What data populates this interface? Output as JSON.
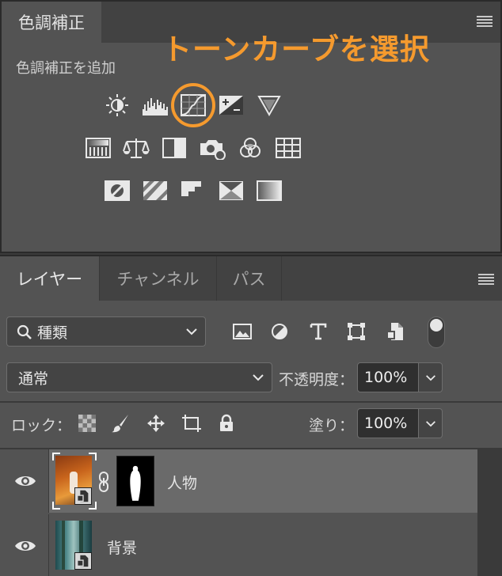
{
  "adjustments": {
    "tab_label": "色調補正",
    "add_label": "色調補正を追加",
    "annotation": "トーンカーブを選択",
    "accent": "#f59a2e",
    "icons_row1": [
      "brightness-contrast-icon",
      "levels-icon",
      "curves-icon",
      "exposure-icon",
      "vibrance-icon"
    ],
    "icons_row2": [
      "hue-saturation-icon",
      "color-balance-icon",
      "black-white-icon",
      "photo-filter-icon",
      "channel-mixer-icon",
      "color-lookup-icon"
    ],
    "icons_row3": [
      "invert-icon",
      "posterize-icon",
      "threshold-icon",
      "selective-color-icon",
      "gradient-map-icon"
    ]
  },
  "layers_panel": {
    "tabs": [
      {
        "label": "レイヤー",
        "active": true
      },
      {
        "label": "チャンネル",
        "active": false
      },
      {
        "label": "パス",
        "active": false
      }
    ],
    "filter": {
      "label": "種類"
    },
    "blend_mode": {
      "value": "通常"
    },
    "opacity": {
      "label": "不透明度：",
      "value": "100%"
    },
    "lock": {
      "label": "ロック："
    },
    "fill": {
      "label": "塗り：",
      "value": "100%"
    },
    "layers": [
      {
        "name": "人物",
        "visible": true,
        "selected": true,
        "has_mask": true
      },
      {
        "name": "背景",
        "visible": true,
        "selected": false,
        "has_mask": false
      }
    ]
  }
}
